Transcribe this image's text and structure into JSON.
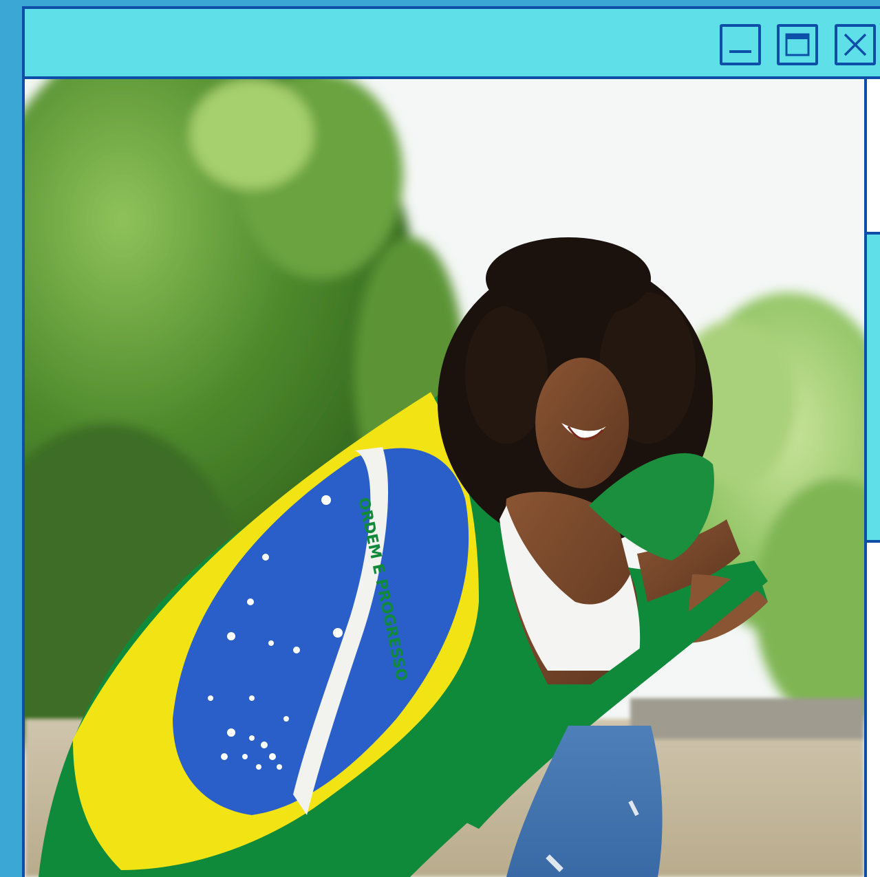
{
  "window": {
    "controls": {
      "minimize_icon": "minimize-icon",
      "maximize_icon": "maximize-icon",
      "close_icon": "close-icon"
    }
  },
  "photo": {
    "subject": "woman-with-flag",
    "flag_text": "ORDEM E PROGRESSO"
  },
  "colors": {
    "desktop": "#3ba7d4",
    "titlebar": "#5fe0e8",
    "border": "#0d4fa8",
    "flag_green": "#0f8a3a",
    "flag_yellow": "#f2e414",
    "flag_blue": "#2a5fc9"
  }
}
